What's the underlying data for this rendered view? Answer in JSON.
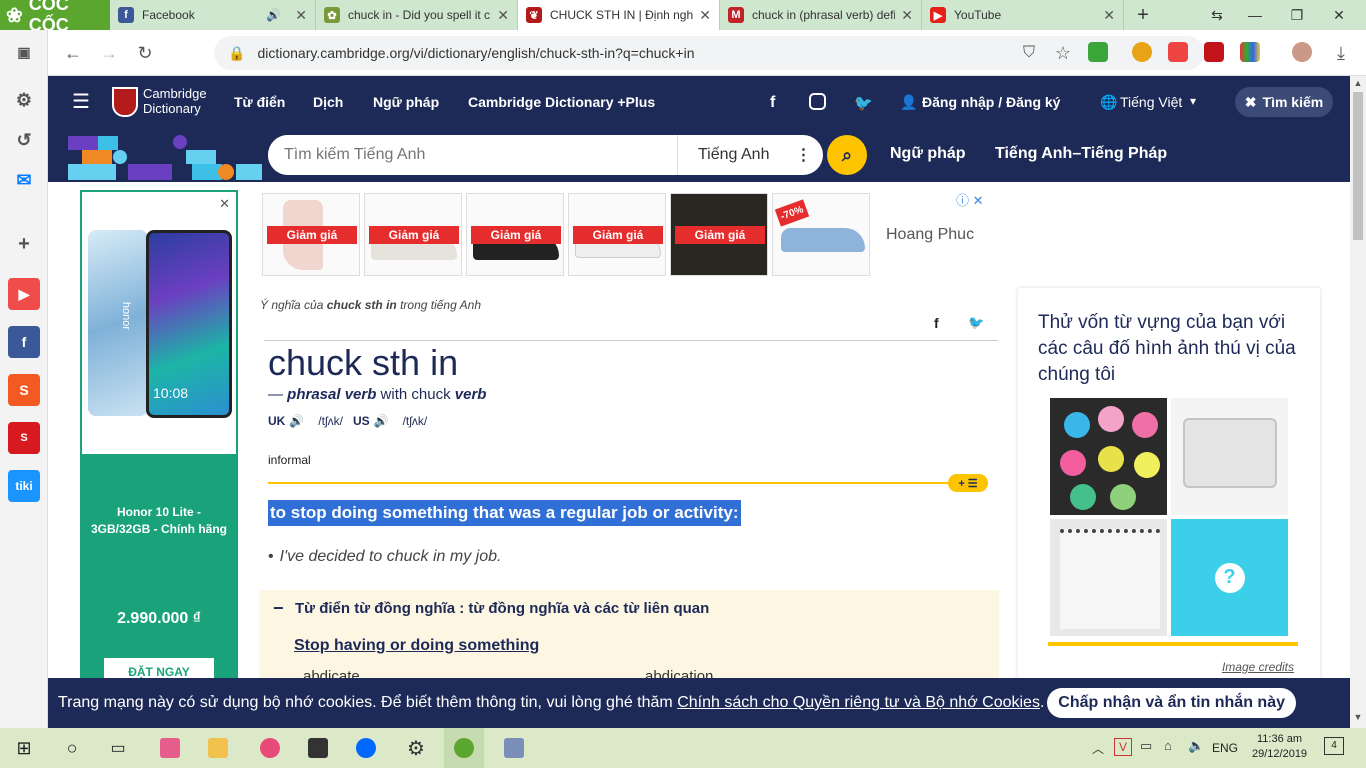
{
  "browser": {
    "logo_text": "CỐC CỐC",
    "tabs": [
      {
        "title": "Facebook",
        "color": "#3b5998",
        "glyph": "f"
      },
      {
        "title": "chuck in - Did you spell it c...",
        "color": "#7a9a3a",
        "glyph": "✿"
      },
      {
        "title": "CHUCK STH IN | Định nghĩa...",
        "color": "#b31b1b",
        "glyph": "❦"
      },
      {
        "title": "chuck in (phrasal verb) defi...",
        "color": "#c0232a",
        "glyph": "M"
      },
      {
        "title": "YouTube",
        "color": "#e62117",
        "glyph": "▶"
      }
    ],
    "new_tab": "+",
    "url": "dictionary.cambridge.org/vi/dictionary/english/chuck-sth-in?q=chuck+in"
  },
  "site": {
    "brand_line1": "Cambridge",
    "brand_line2": "Dictionary",
    "nav": [
      "Từ điển",
      "Dịch",
      "Ngữ pháp",
      "Cambridge Dictionary +Plus"
    ],
    "login": "Đăng nhập / Đăng ký",
    "language": "Tiếng Việt",
    "search_toggle": "Tìm kiếm",
    "search_placeholder": "Tìm kiếm Tiếng Anh",
    "search_lang": "Tiếng Anh",
    "nav2": [
      "Ngữ pháp",
      "Tiếng Anh–Tiếng Pháp"
    ]
  },
  "ad_left": {
    "screen_time": "10:08",
    "phone_brand": "honor",
    "product": "Honor 10 Lite - 3GB/32GB - Chính hãng",
    "price": "2.990.000 ₫",
    "button": "ĐẶT NGAY"
  },
  "ad_top": {
    "sale_label": "Giảm giá",
    "discount": "-70%",
    "brand": "Hoang Phuc"
  },
  "entry": {
    "breadcrumb_prefix": "Ý nghĩa của ",
    "breadcrumb_term": "chuck sth in",
    "breadcrumb_suffix": " trong tiếng Anh",
    "headword": "chuck sth in",
    "pos_dash": "— ",
    "pos": "phrasal verb",
    "with_text": " with chuck ",
    "with_pos": "verb",
    "uk_label": "UK",
    "uk_ipa": "/tʃʌk/",
    "us_label": "US",
    "us_ipa": "/tʃʌk/",
    "register": "informal",
    "definition": "to stop doing something that was a regular job or activity:",
    "example": "I've decided to chuck in my job.",
    "thesaurus_title": "Từ điển từ đồng nghĩa : từ đồng nghĩa và các từ liên quan",
    "thesaurus_link": "Stop having or doing something",
    "syn1": "abdicate",
    "syn2": "abdication"
  },
  "right_panel": {
    "quiz_text": "Thử vốn từ vựng của bạn với các câu đố hình ảnh thú vị của chúng tôi",
    "quiz_mark": "?",
    "credits": "Image credits"
  },
  "cookie": {
    "text": "Trang mạng này có sử dụng bộ nhớ cookies. Để biết thêm thông tin, vui lòng ghé thăm ",
    "link": "Chính sách cho Quyền riêng tư và Bộ nhớ Cookies",
    "period": ".",
    "accept": "Chấp nhận và ẩn tin nhắn này"
  },
  "taskbar": {
    "lang": "ENG",
    "time": "11:36 am",
    "date": "29/12/2019",
    "notifications": "4"
  },
  "colors": {
    "brand_navy": "#1d2a57",
    "accent_yellow": "#fec400",
    "highlight_blue": "#2f6fd6"
  }
}
